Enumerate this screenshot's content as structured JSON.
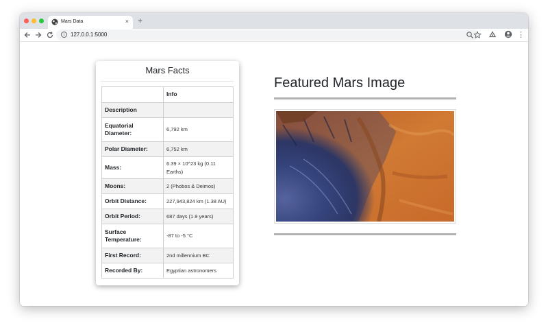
{
  "browser": {
    "tab_title": "Mars Data",
    "tab_close": "×",
    "new_tab": "+",
    "url": "127.0.0.1:5000",
    "info_glyph": "i",
    "menu_glyph": "⋮"
  },
  "icons": {
    "tab": "globe-icon",
    "back": "back-arrow-icon",
    "forward": "forward-arrow-icon",
    "reload": "reload-icon",
    "site_info": "info-icon",
    "zoom": "zoom-icon",
    "bookmark": "star-icon",
    "extension": "extension-icon",
    "profile": "profile-icon",
    "menu": "menu-icon"
  },
  "facts": {
    "title": "Mars Facts",
    "header": [
      "",
      "Info"
    ],
    "rows": [
      {
        "label": "Description",
        "value": ""
      },
      {
        "label": "Equatorial Diameter:",
        "value": "6,792 km"
      },
      {
        "label": "Polar Diameter:",
        "value": "6,752 km"
      },
      {
        "label": "Mass:",
        "value": "6.39 × 10^23 kg (0.11 Earths)"
      },
      {
        "label": "Moons:",
        "value": "2 (Phobos & Deimos)"
      },
      {
        "label": "Orbit Distance:",
        "value": "227,943,824 km (1.38 AU)"
      },
      {
        "label": "Orbit Period:",
        "value": "687 days (1.9 years)"
      },
      {
        "label": "Surface Temperature:",
        "value": "-87 to -5 °C"
      },
      {
        "label": "First Record:",
        "value": "2nd millennium BC"
      },
      {
        "label": "Recorded By:",
        "value": "Egyptian astronomers"
      }
    ]
  },
  "featured": {
    "title": "Featured Mars Image"
  },
  "colors": {
    "traffic_red": "#fd5e56",
    "traffic_yellow": "#febc2e",
    "traffic_green": "#28c840",
    "mars_orange": "#c8692a",
    "crater_blue": "#3a4a86",
    "rule_gray": "#b1b1b1"
  }
}
